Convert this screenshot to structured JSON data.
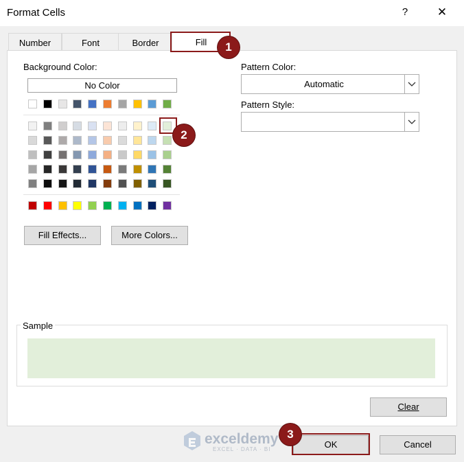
{
  "window": {
    "title": "Format Cells",
    "help": "?",
    "close": "✕"
  },
  "tabs": [
    {
      "label": "Number"
    },
    {
      "label": "Font"
    },
    {
      "label": "Border"
    },
    {
      "label": "Fill"
    }
  ],
  "fill": {
    "background_color_label": "Background Color:",
    "no_color": "No Color",
    "pattern_color_label": "Pattern Color:",
    "pattern_color_value": "Automatic",
    "pattern_style_label": "Pattern Style:",
    "pattern_style_value": "",
    "fill_effects": "Fill Effects...",
    "more_colors": "More Colors...",
    "sample_label": "Sample",
    "sample_color": "#e2efda",
    "selected_color": "#e2efda",
    "standard_row": [
      "#ffffff",
      "#000000",
      "#e7e6e6",
      "#44546a",
      "#4472c4",
      "#ed7d31",
      "#a5a5a5",
      "#ffc000",
      "#5b9bd5",
      "#70ad47"
    ],
    "theme_rows": [
      [
        "#f2f2f2",
        "#7f7f7f",
        "#d0cece",
        "#d6dce4",
        "#d9e1f2",
        "#fce4d6",
        "#ededed",
        "#fff2cc",
        "#ddebf7",
        "#e2efda"
      ],
      [
        "#d9d9d9",
        "#595959",
        "#aeaaaa",
        "#adb9ca",
        "#b4c6e7",
        "#f8cbad",
        "#dbdbdb",
        "#ffe699",
        "#bdd7ee",
        "#c6e0b4"
      ],
      [
        "#bfbfbf",
        "#404040",
        "#757171",
        "#8497b0",
        "#8ea9db",
        "#f4b084",
        "#c9c9c9",
        "#ffd966",
        "#9bc2e6",
        "#a9d08e"
      ],
      [
        "#a6a6a6",
        "#262626",
        "#3a3838",
        "#333f4f",
        "#305496",
        "#c65911",
        "#7b7b7b",
        "#bf8f00",
        "#2f75b5",
        "#548235"
      ],
      [
        "#808080",
        "#0d0d0d",
        "#161616",
        "#222b35",
        "#203764",
        "#833c0c",
        "#525252",
        "#806000",
        "#1f4e78",
        "#375623"
      ]
    ],
    "accent_row": [
      "#c00000",
      "#ff0000",
      "#ffc000",
      "#ffff00",
      "#92d050",
      "#00b050",
      "#00b0f0",
      "#0070c0",
      "#002060",
      "#7030a0"
    ]
  },
  "buttons": {
    "clear": "Clear",
    "ok": "OK",
    "cancel": "Cancel"
  },
  "markers": [
    "1",
    "2",
    "3"
  ],
  "watermark": {
    "name": "exceldemy",
    "tagline": "EXCEL · DATA · BI"
  },
  "colors": {
    "marker": "#8b1a1a",
    "panel_border": "#d9d9d9"
  }
}
